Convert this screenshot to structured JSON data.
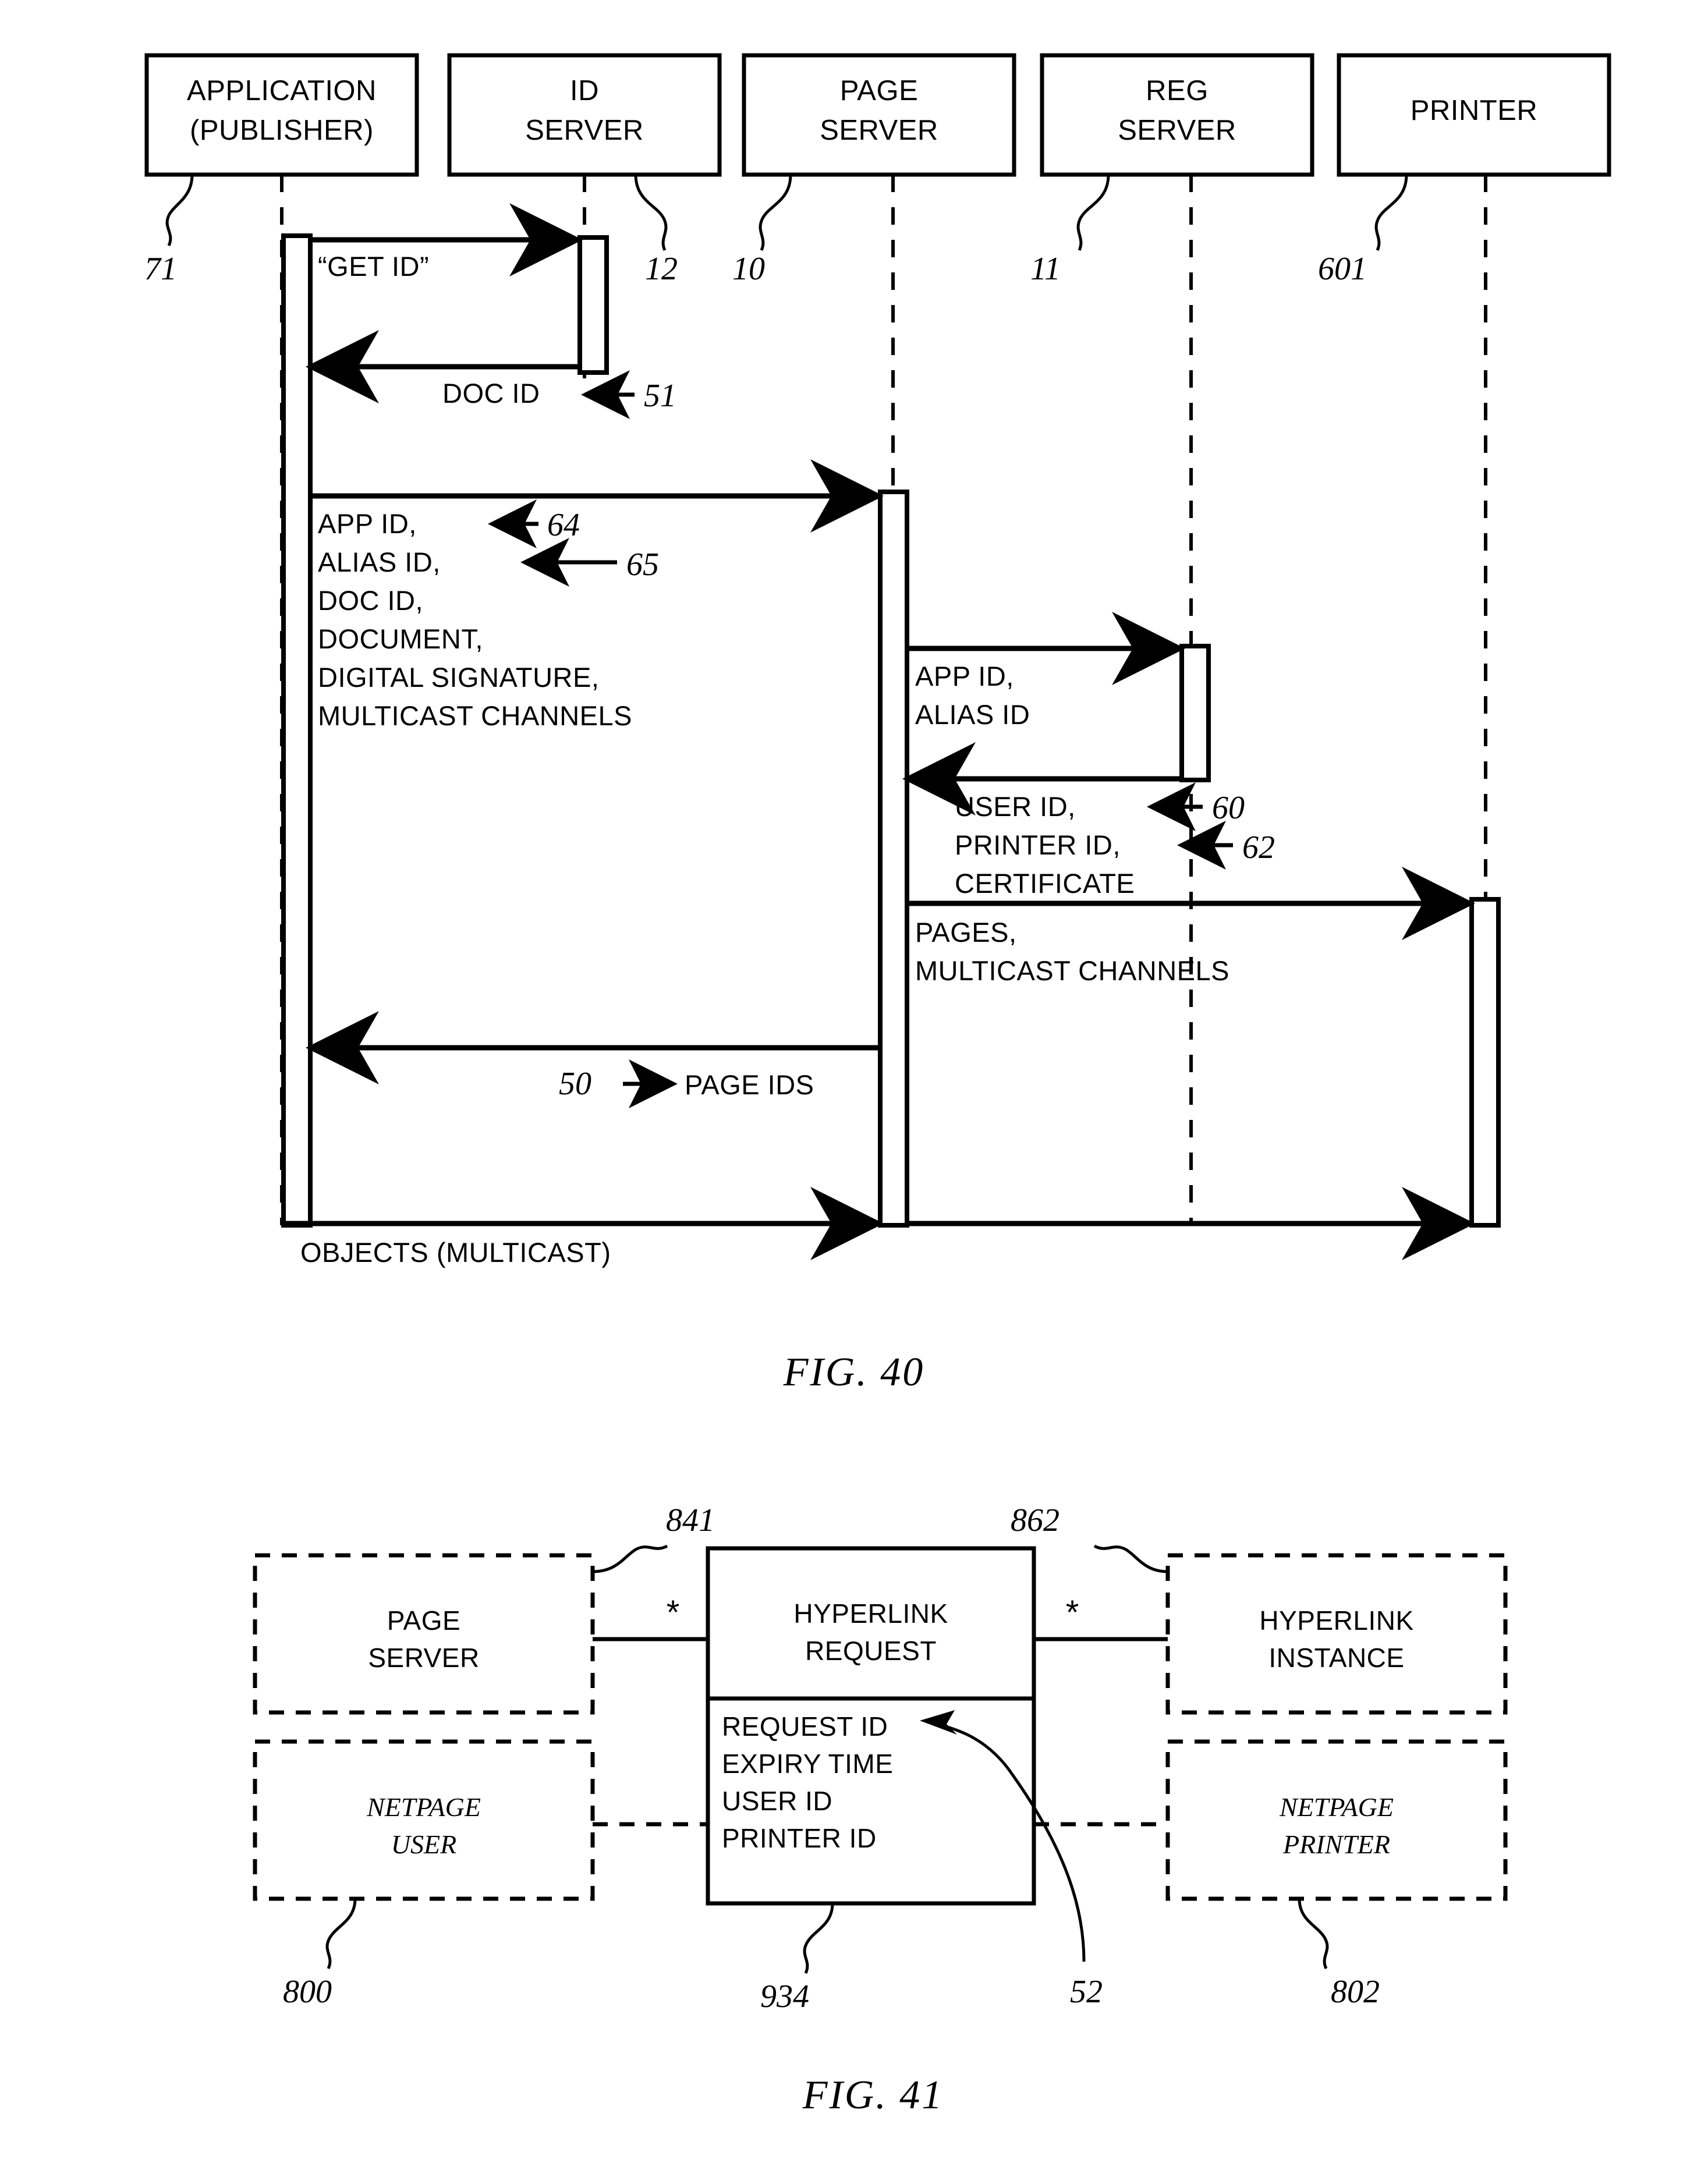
{
  "document": {
    "type": "patent-figure-sheet",
    "figures": [
      "FIG. 40",
      "FIG. 41"
    ]
  },
  "fig40": {
    "caption": "FIG. 40",
    "participants": [
      {
        "id": "application",
        "lines": [
          "APPLICATION",
          "(PUBLISHER)"
        ],
        "ref": "71"
      },
      {
        "id": "id_server",
        "lines": [
          "ID",
          "SERVER"
        ],
        "ref": "12"
      },
      {
        "id": "page_server",
        "lines": [
          "PAGE",
          "SERVER"
        ],
        "ref": "10"
      },
      {
        "id": "reg_server",
        "lines": [
          "REG",
          "SERVER"
        ],
        "ref": "11"
      },
      {
        "id": "printer",
        "lines": [
          "PRINTER"
        ],
        "ref": "601"
      }
    ],
    "extra_ref_after_id_server": "10",
    "messages": [
      {
        "id": "get_id",
        "label": "“GET ID”",
        "from": "application",
        "to": "id_server",
        "direction": "right"
      },
      {
        "id": "doc_id",
        "label": "DOC ID",
        "ref": "51",
        "from": "id_server",
        "to": "application",
        "direction": "left"
      },
      {
        "id": "publish",
        "label_lines": [
          "APP ID,",
          "ALIAS ID,",
          "DOC ID,",
          "DOCUMENT,",
          "DIGITAL SIGNATURE,",
          "MULTICAST CHANNELS"
        ],
        "refs": [
          "64",
          "65"
        ],
        "from": "application",
        "to": "page_server",
        "direction": "right"
      },
      {
        "id": "lookup",
        "label_lines": [
          "APP ID,",
          "ALIAS ID"
        ],
        "from": "page_server",
        "to": "reg_server",
        "direction": "right"
      },
      {
        "id": "lookup_reply",
        "label_lines": [
          "USER ID,",
          "PRINTER ID,",
          "CERTIFICATE"
        ],
        "refs": [
          "60",
          "62"
        ],
        "from": "reg_server",
        "to": "page_server",
        "direction": "left"
      },
      {
        "id": "pages",
        "label_lines": [
          "PAGES,",
          "MULTICAST CHANNELS"
        ],
        "from": "page_server",
        "to": "printer",
        "direction": "right"
      },
      {
        "id": "page_ids",
        "label": "PAGE IDS",
        "ref": "50",
        "from": "page_server",
        "to": "application",
        "direction": "left"
      },
      {
        "id": "objects",
        "label": "OBJECTS (MULTICAST)",
        "from": "application",
        "to": "printer",
        "direction": "right"
      }
    ]
  },
  "fig41": {
    "caption": "FIG. 41",
    "nodes": [
      {
        "id": "page_server",
        "lines": [
          "PAGE",
          "SERVER"
        ],
        "style": "dashed",
        "italic": false,
        "ref": null
      },
      {
        "id": "netpage_user",
        "lines": [
          "NETPAGE",
          "USER"
        ],
        "style": "dashed",
        "italic": true,
        "ref": "800"
      },
      {
        "id": "hyperlink_request",
        "lines": [
          "HYPERLINK",
          "REQUEST"
        ],
        "style": "solid",
        "italic": false,
        "ref": "934",
        "attributes": [
          "REQUEST ID",
          "EXPIRY TIME",
          "USER ID",
          "PRINTER ID"
        ],
        "attributes_ref": "52"
      },
      {
        "id": "hyperlink_instance",
        "lines": [
          "HYPERLINK",
          "INSTANCE"
        ],
        "style": "dashed",
        "italic": false,
        "ref": null
      },
      {
        "id": "netpage_printer",
        "lines": [
          "NETPAGE",
          "PRINTER"
        ],
        "style": "dashed",
        "italic": true,
        "ref": "802"
      }
    ],
    "multiplicity_left": "*",
    "multiplicity_right": "*",
    "association_refs": {
      "left": "841",
      "right": "862"
    }
  }
}
